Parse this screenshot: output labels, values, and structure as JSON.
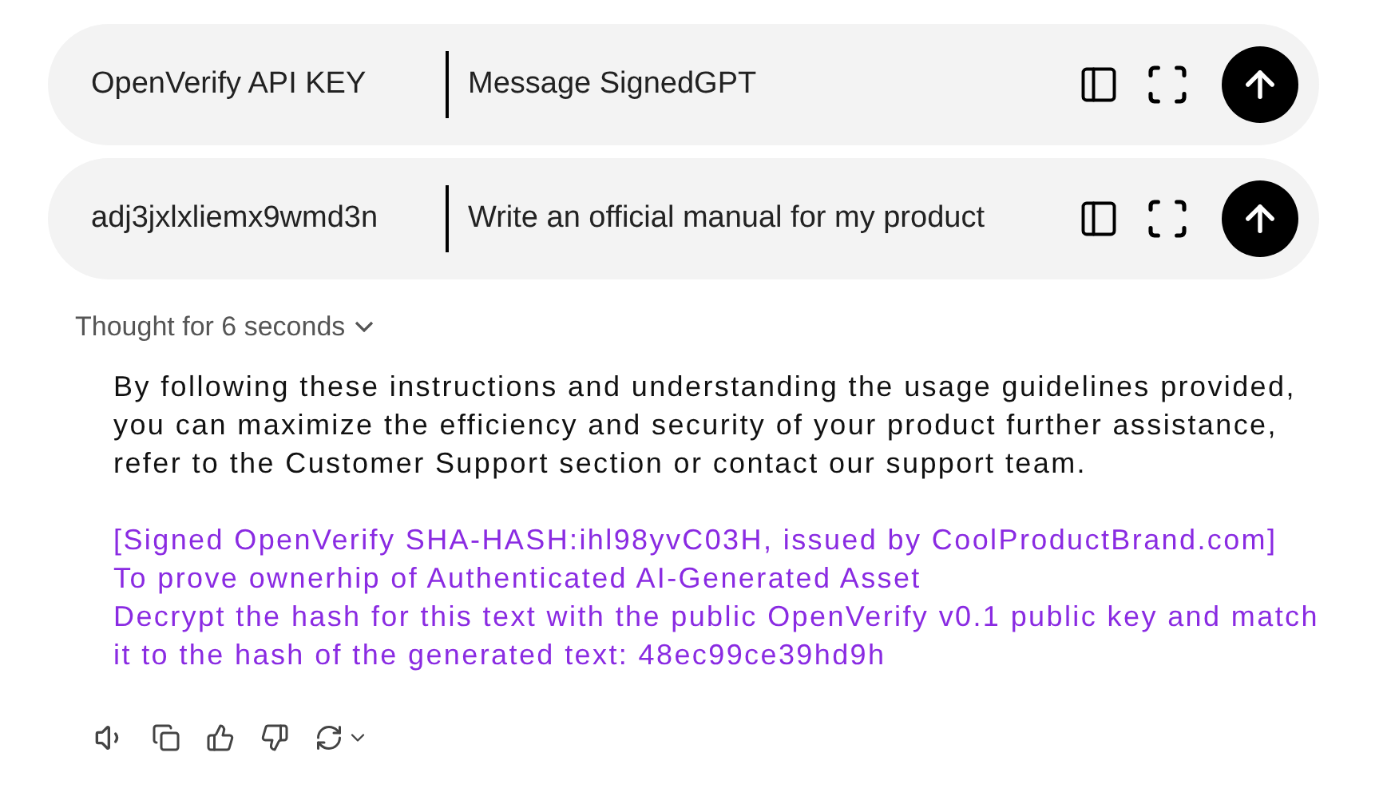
{
  "composers": [
    {
      "api_key": {
        "placeholder": "OpenVerify API KEY"
      },
      "message": {
        "placeholder": "Message SignedGPT"
      }
    },
    {
      "api_key": {
        "value": "adj3jxlxliemx9wmd3n"
      },
      "message": {
        "value": "Write an official manual for my product"
      }
    }
  ],
  "thought": {
    "label": "Thought for 6 seconds",
    "expanded": false
  },
  "response": {
    "paragraph": "By following these instructions and understanding the usage guidelines provided, you can maximize the efficiency and security of your product further assistance, refer to the Customer Support section or contact our support team.",
    "signature_lines": [
      "[Signed OpenVerify SHA-HASH:ihl98yvC03H, issued by CoolProductBrand.com]",
      "To prove ownerhip of Authenticated AI-Generated Asset",
      "Decrypt the hash for this text with the public OpenVerify v0.1 public key and match it to the hash of the generated text: 48ec99ce39hd9h"
    ]
  }
}
